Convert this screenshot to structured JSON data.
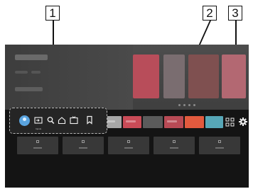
{
  "callouts": {
    "one": "1",
    "two": "2",
    "three": "3"
  },
  "nav_bar": {
    "items": [
      {
        "icon": "profile-avatar-icon"
      },
      {
        "icon": "input-source-icon",
        "label": "Inputs"
      },
      {
        "icon": "search-icon"
      },
      {
        "icon": "home-icon"
      },
      {
        "icon": "live-tv-icon"
      },
      {
        "icon": "bookmark-icon"
      }
    ]
  },
  "right_controls": {
    "apps_icon": "apps-grid-icon",
    "settings_icon": "gear-icon"
  },
  "colors": {
    "avatar": "#5aa4df",
    "app_tiles": [
      "#a7a7a7",
      "#c94b57",
      "#5b5b5b",
      "#b84a55",
      "#e25a3e",
      "#57a7b7"
    ],
    "hero_thumbs": [
      "#b84d5a",
      "#7a6d70",
      "#7f5050",
      "#b36872"
    ]
  }
}
